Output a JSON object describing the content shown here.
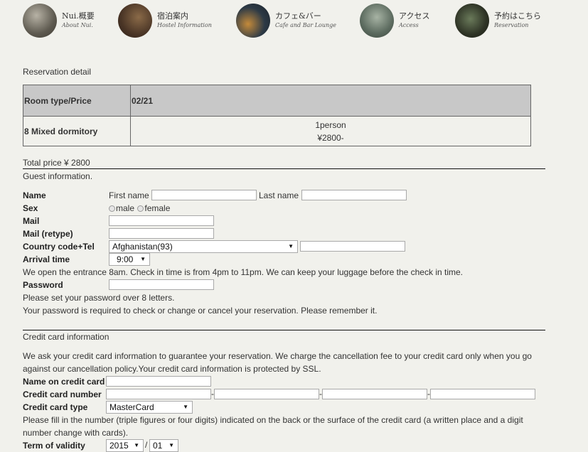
{
  "nav": [
    {
      "jp": "Nui.概要",
      "en": "About Nui."
    },
    {
      "jp": "宿泊案内",
      "en": "Hostel Information"
    },
    {
      "jp": "カフェ&バー",
      "en": "Cafe and Bar Lounge"
    },
    {
      "jp": "アクセス",
      "en": "Access"
    },
    {
      "jp": "予約はこちら",
      "en": "Reservation"
    }
  ],
  "reservation": {
    "heading": "Reservation detail",
    "table": {
      "header_col1": "Room type/Price",
      "header_col2": "02/21",
      "room": "8 Mixed dormitory",
      "persons": "1person",
      "price": "¥2800-"
    },
    "total": "Total price ¥ 2800"
  },
  "guest": {
    "heading": "Guest information.",
    "name_label": "Name",
    "first_name_label": "First name",
    "last_name_label": "Last name",
    "sex_label": "Sex",
    "male": "male",
    "female": "female",
    "mail_label": "Mail",
    "mail_retype_label": "Mail (retype)",
    "country_label": "Country code+Tel",
    "country_value": "Afghanistan(93)",
    "arrival_label": "Arrival time",
    "arrival_value": "9:00",
    "arrival_note": "We open the entrance 8am. Check in time is from 4pm to 11pm. We can keep your luggage before the check in time.",
    "password_label": "Password",
    "password_note1": "Please set your password over 8 letters.",
    "password_note2": "Your password is required to check or change or cancel your reservation. Please remember it."
  },
  "credit": {
    "heading": "Credit card information",
    "intro_line1": "We ask your credit card information to guarantee your reservation. We charge the cancellation fee to your credit card only when you go",
    "intro_line2": "against our cancellation policy.Your credit card information is protected by SSL.",
    "name_label": "Name on credit card",
    "number_label": "Credit card number",
    "number_sep": "-",
    "type_label": "Credit card type",
    "type_value": "MasterCard",
    "cvv_line1": "Please fill in the number (triple figures or four digits) indicated on the back or the surface of the credit card (a written place and a digit",
    "cvv_line2": "number change with cards).",
    "validity_label": "Term of validity",
    "validity_year": "2015",
    "validity_sep": "/",
    "validity_month": "01"
  }
}
